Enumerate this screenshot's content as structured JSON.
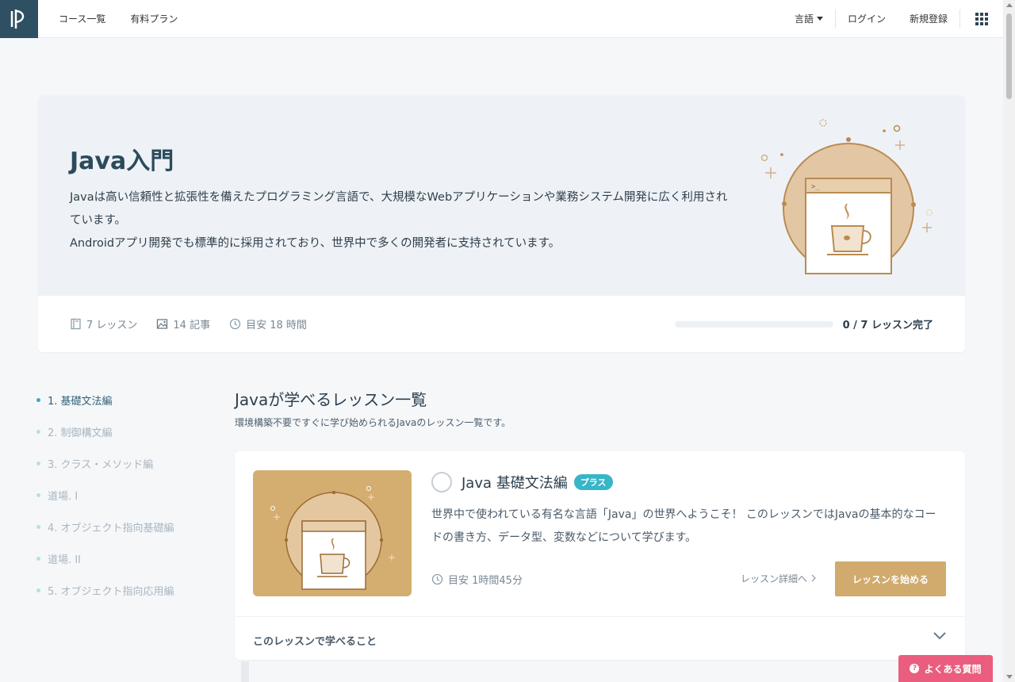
{
  "header": {
    "nav_left": [
      "コース一覧",
      "有料プラン"
    ],
    "language_label": "言語",
    "login_label": "ログイン",
    "signup_label": "新規登録"
  },
  "hero": {
    "title": "Java入門",
    "description_line1": "Javaは高い信頼性と拡張性を備えたプログラミング言語で、大規模なWebアプリケーションや業務システム開発に広く利用されています。",
    "description_line2": "Androidアプリ開発でも標準的に採用されており、世界中で多くの開発者に支持されています。",
    "lessons": "7 レッスン",
    "articles": "14 記事",
    "duration": "目安 18 時間",
    "progress_text": "0 / 7 レッスン完了",
    "progress_fraction": 0
  },
  "sidebar": {
    "items": [
      {
        "label": "1. 基礎文法編",
        "active": true
      },
      {
        "label": "2. 制御構文編",
        "active": false
      },
      {
        "label": "3. クラス・メソッド編",
        "active": false
      },
      {
        "label": "道場. I",
        "active": false
      },
      {
        "label": "4. オブジェクト指向基礎編",
        "active": false
      },
      {
        "label": "道場. II",
        "active": false
      },
      {
        "label": "5. オブジェクト指向応用編",
        "active": false
      }
    ]
  },
  "main": {
    "section_title": "Javaが学べるレッスン一覧",
    "section_subtitle": "環境構築不要ですぐに学び始められるJavaのレッスン一覧です。",
    "card": {
      "title": "Java 基礎文法編",
      "badge": "プラス",
      "description": "世界中で使われている有名な言語「Java」の世界へようこそ！ このレッスンではJavaの基本的なコードの書き方、データ型、変数などについて学びます。",
      "time": "目安 1時間45分",
      "detail_link": "レッスン詳細へ",
      "start_button": "レッスンを始める",
      "footer_label": "このレッスンで学べること"
    }
  },
  "faq_button": "よくある質問",
  "colors": {
    "brand_dark": "#2f5062",
    "accent_gold": "#d0ab6d",
    "badge_teal": "#37b5c9",
    "faq_pink": "#ea5d7e"
  }
}
